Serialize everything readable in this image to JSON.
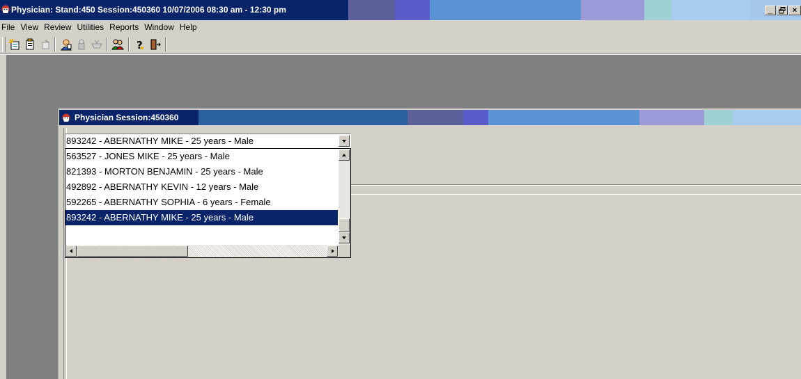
{
  "app": {
    "title": "Physician: Stand:450 Session:450360 10/07/2006 08:30 am - 12:30 pm",
    "window_buttons": {
      "minimize": "_",
      "maximize": "🗗",
      "close": "×"
    }
  },
  "menu": [
    "File",
    "View",
    "Review",
    "Utilities",
    "Reports",
    "Window",
    "Help"
  ],
  "toolbar": {
    "buttons": [
      "new-patient-icon",
      "clipboard-icon",
      "notes-icon",
      "physician-icon",
      "hand-icon",
      "tray-icon",
      "users-icon",
      "help-icon",
      "exit-icon"
    ]
  },
  "child_window": {
    "title": "Physician Session:450360"
  },
  "patient_combo": {
    "selected_value": "893242 - ABERNATHY MIKE - 25  years  - Male",
    "options": [
      "563527 - JONES MIKE - 25  years  - Male",
      "821393 - MORTON BENJAMIN - 25  years  - Male",
      "492892 - ABERNATHY KEVIN - 12  years  - Male",
      "592265 - ABERNATHY SOPHIA - 6   years  - Female",
      "893242 - ABERNATHY MIKE - 25  years  - Male"
    ],
    "selected_index": 4
  },
  "colors": {
    "title_active": "#0a246a",
    "face": "#d4d0c8",
    "workspace": "#808080",
    "selection": "#0a246a"
  }
}
